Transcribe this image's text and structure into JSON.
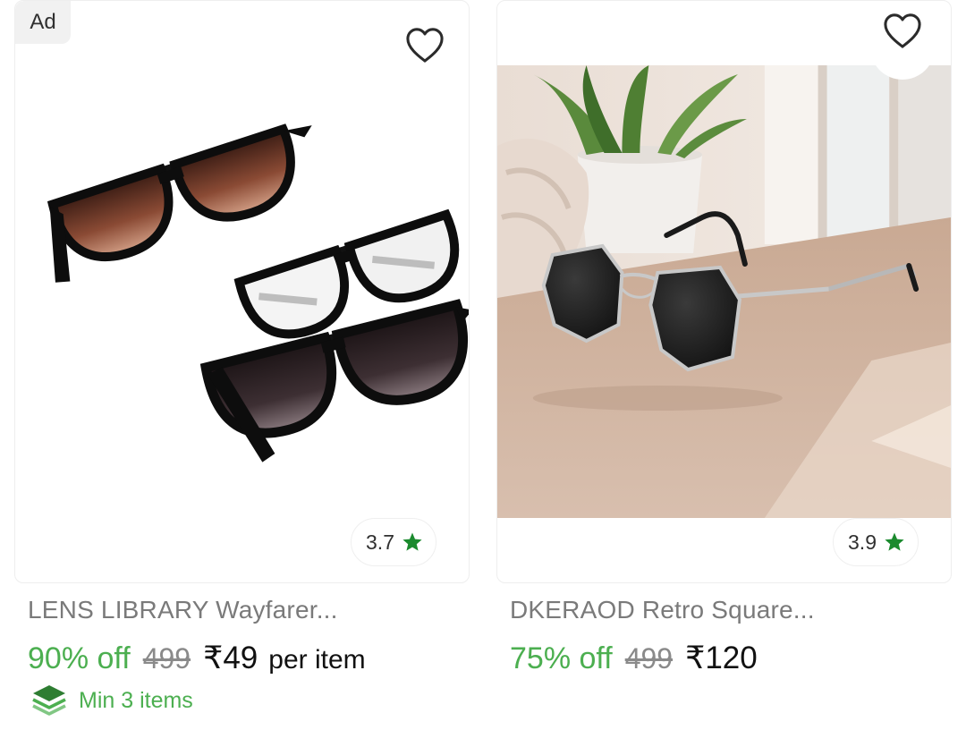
{
  "products": [
    {
      "ad_label": "Ad",
      "wishlist_icon": "heart-outline-icon",
      "rating": "3.7",
      "rating_icon": "star-icon",
      "title": "LENS LIBRARY Wayfarer...",
      "discount": "90% off",
      "mrp": "499",
      "price": "₹49",
      "per_unit": "per item",
      "min_qty_icon": "stack-layers-icon",
      "min_qty": "Min 3 items"
    },
    {
      "wishlist_icon": "heart-outline-icon",
      "rating": "3.9",
      "rating_icon": "star-icon",
      "title": "DKERAOD Retro Square...",
      "discount": "75% off",
      "mrp": "499",
      "price": "₹120"
    }
  ],
  "colors": {
    "discount_green": "#4caf50",
    "star_green": "#1b8a2e",
    "text_dark": "#212121",
    "text_muted": "#7a7a7a"
  }
}
